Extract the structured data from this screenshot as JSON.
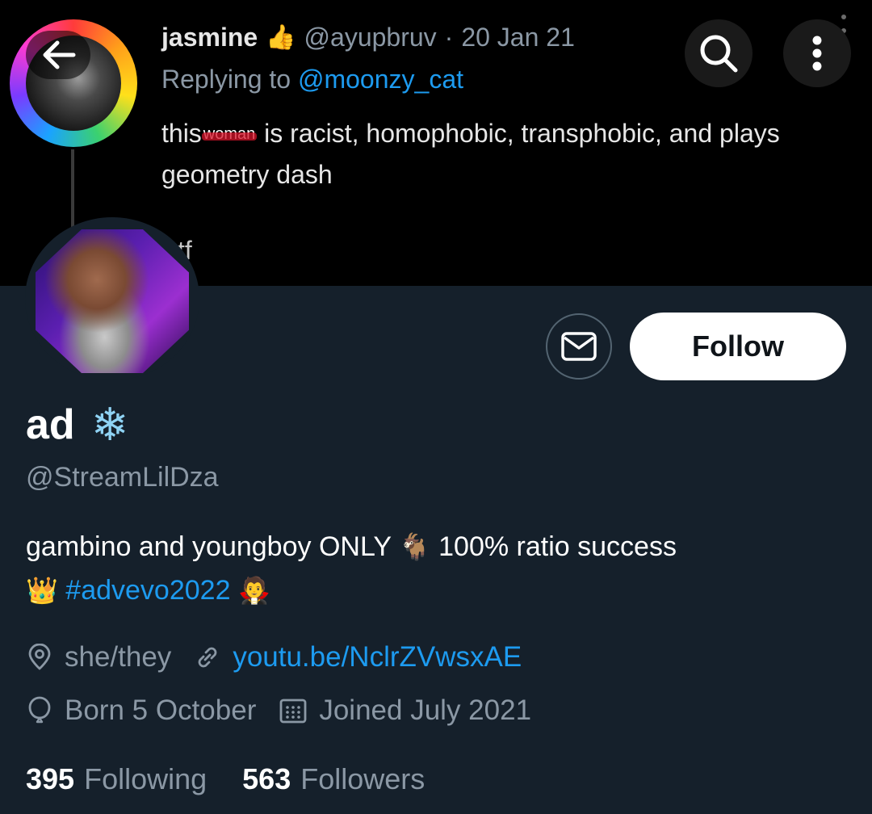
{
  "tweet": {
    "author_name": "jasmine",
    "author_badge": "👍",
    "author_handle": "@ayupbruv",
    "separator": "·",
    "date": "20 Jan 21",
    "replying_prefix": "Replying to",
    "replying_handle": "@moonzy_cat",
    "text_before": "this",
    "text_struck": "woman",
    "text_after": " is racist, homophobic, transphobic, and plays geometry dash",
    "text_tail": "tf"
  },
  "profile": {
    "follow_label": "Follow",
    "display_name": "ad",
    "display_emoji": "❄",
    "handle": "@StreamLilDza",
    "bio": {
      "part1": "gambino and youngboy ONLY ",
      "goat_emoji": "🐐",
      "part2": " 100% ratio success ",
      "crown_emoji": "👑",
      "hashtag": "#advevo2022",
      "vampire_emoji": "🧛"
    },
    "pronouns": "she/they",
    "website": "youtu.be/NclrZVwsxAE",
    "birthday": "Born 5 October",
    "joined": "Joined July 2021",
    "following_count": "395",
    "following_label": "Following",
    "followers_count": "563",
    "followers_label": "Followers"
  },
  "colors": {
    "background": "#15202b",
    "accent": "#1d9bf0",
    "muted": "#8b98a5"
  },
  "icons": {
    "back": "arrow-left-icon",
    "search": "search-icon",
    "more": "more-vertical-icon",
    "message": "envelope-icon",
    "location": "location-pin-icon",
    "link": "link-icon",
    "birthday": "balloon-icon",
    "calendar": "calendar-icon"
  }
}
